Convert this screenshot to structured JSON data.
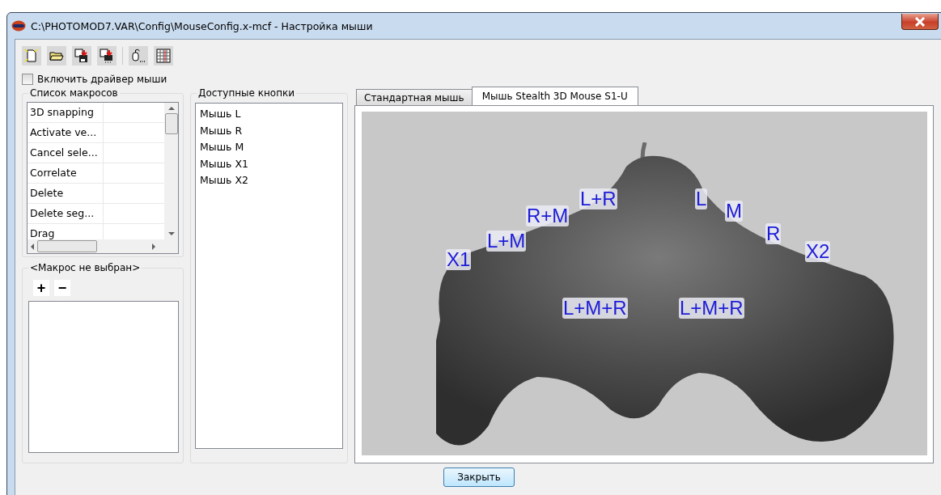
{
  "window": {
    "title": "C:\\PHOTOMOD7.VAR\\Config\\MouseConfig.x-mcf - Настройка мыши"
  },
  "driver_checkbox": {
    "label": "Включить драйвер мыши",
    "checked": false
  },
  "macros": {
    "title": "Список макросов",
    "rows": [
      {
        "name": "3D snapping"
      },
      {
        "name": "Activate ve..."
      },
      {
        "name": "Cancel sele..."
      },
      {
        "name": "Correlate"
      },
      {
        "name": "Delete"
      },
      {
        "name": "Delete seg..."
      },
      {
        "name": "Drag"
      }
    ]
  },
  "macro_editor": {
    "title": "<Макрос не выбран>",
    "add": "+",
    "remove": "−"
  },
  "available_buttons": {
    "title": "Доступные кнопки",
    "items": [
      "Мышь L",
      "Мышь R",
      "Мышь M",
      "Мышь X1",
      "Мышь X2"
    ]
  },
  "tabs": [
    {
      "label": "Стандартная мышь",
      "selected": false
    },
    {
      "label": "Мышь Stealth 3D Mouse S1-U",
      "selected": true
    }
  ],
  "mouse_labels": [
    "X1",
    "L+M",
    "R+M",
    "L+R",
    "L",
    "M",
    "R",
    "X2",
    "L+M+R",
    "L+M+R"
  ],
  "close_button": "Закрыть"
}
